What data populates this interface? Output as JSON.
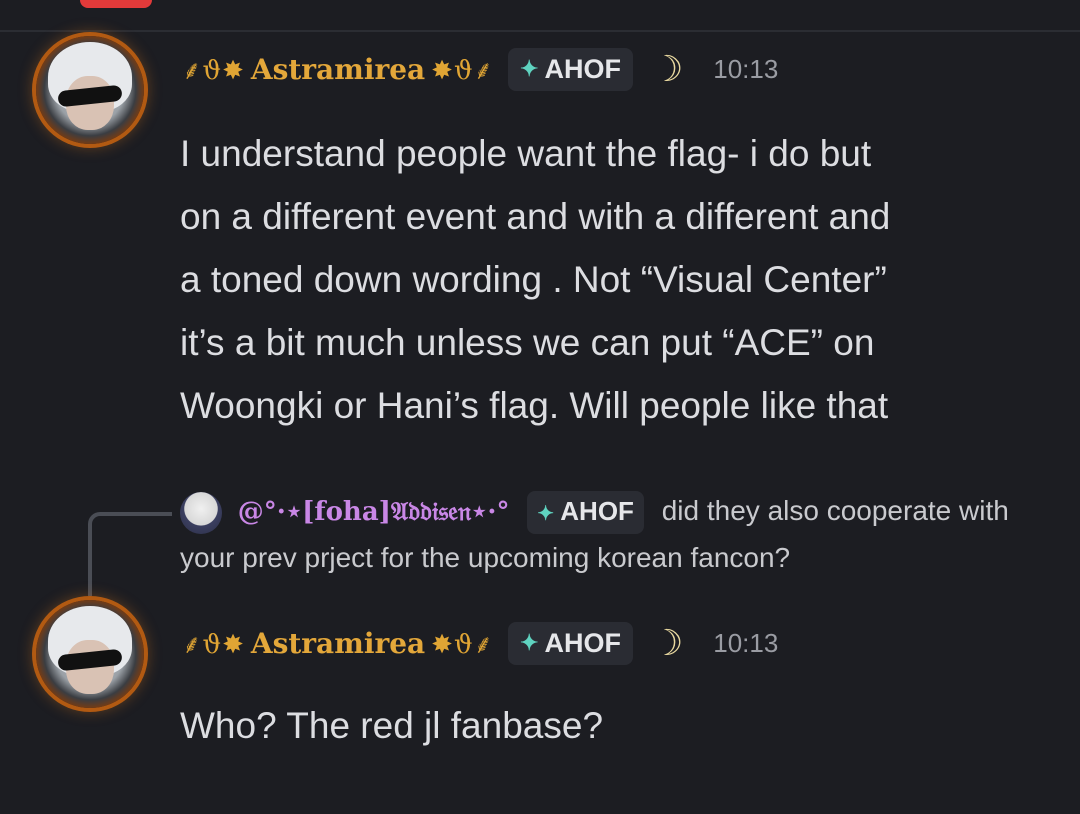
{
  "messages": [
    {
      "username_left_deco": "⸙ϑ✸",
      "username": "Astramirea",
      "username_right_deco": "✸ϑ⸙",
      "role_tag": "AHOF",
      "moon": "☽",
      "time": "10:13",
      "lines": [
        "I understand people want the flag- i do but",
        "on a different event and with a different and",
        "a toned down wording . Not “Visual Center”",
        "it’s a bit much unless we can put “ACE” on",
        "Woongki or Hani’s flag. Will people like that"
      ]
    },
    {
      "username_left_deco": "⸙ϑ✸",
      "username": "Astramirea",
      "username_right_deco": "✸ϑ⸙",
      "role_tag": "AHOF",
      "moon": "☽",
      "time": "10:13",
      "lines": [
        "Who? The red jl fanbase?"
      ]
    }
  ],
  "reply": {
    "username": "@°·⋆[foha]𝔄𝔡𝔡𝔦𝔰𝔢𝔫⋆·°",
    "role_tag": "AHOF",
    "text": "did they also cooperate with your prev prject for  the upcoming korean fancon?"
  },
  "icons": {
    "gem": "✦",
    "moon": "crescent-moon-icon"
  }
}
